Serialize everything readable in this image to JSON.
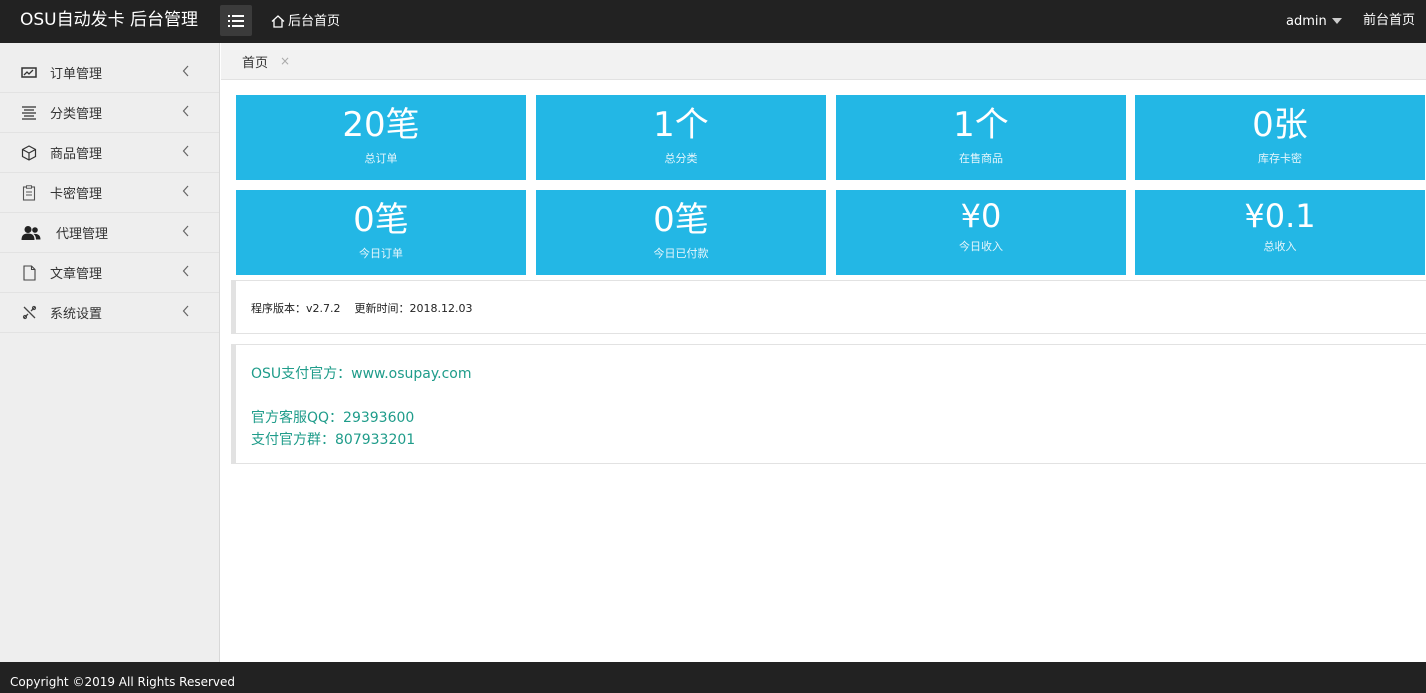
{
  "header": {
    "brand": "OSU自动发卡 后台管理",
    "home_link": "后台首页",
    "user": "admin",
    "front_link": "前台首页"
  },
  "sidebar": {
    "items": [
      {
        "label": "订单管理",
        "icon": "chart-board-icon"
      },
      {
        "label": "分类管理",
        "icon": "list-lines-icon"
      },
      {
        "label": "商品管理",
        "icon": "cube-icon"
      },
      {
        "label": "卡密管理",
        "icon": "clipboard-icon"
      },
      {
        "label": "代理管理",
        "icon": "users-icon"
      },
      {
        "label": "文章管理",
        "icon": "document-icon"
      },
      {
        "label": "系统设置",
        "icon": "tools-icon"
      }
    ]
  },
  "tabs": [
    {
      "label": "首页",
      "close": "×"
    }
  ],
  "stats": [
    {
      "value": "20笔",
      "label": "总订单"
    },
    {
      "value": "1个",
      "label": "总分类"
    },
    {
      "value": "1个",
      "label": "在售商品"
    },
    {
      "value": "0张",
      "label": "库存卡密"
    },
    {
      "value": "0笔",
      "label": "今日订单"
    },
    {
      "value": "0笔",
      "label": "今日已付款"
    },
    {
      "value": "¥0",
      "label": "今日收入"
    },
    {
      "value": "¥0.1",
      "label": "总收入"
    }
  ],
  "version": {
    "program": "程序版本：v2.7.2",
    "updated": "更新时间：2018.12.03"
  },
  "contact": {
    "official": "OSU支付官方：www.osupay.com",
    "qq": "官方客服QQ：29393600",
    "group": "支付官方群：807933201"
  },
  "footer": {
    "copyright": "Copyright ©2019 All Rights Reserved"
  },
  "colors": {
    "header_bg": "#222222",
    "card_bg": "#23b7e5",
    "contact_text": "#1f9c8a",
    "sidebar_bg": "#eeeeee"
  }
}
